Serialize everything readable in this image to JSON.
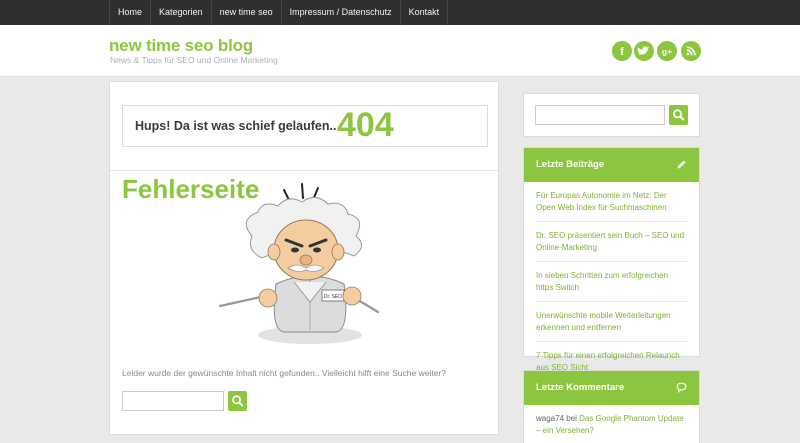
{
  "nav": {
    "items": [
      "Home",
      "Kategorien",
      "new time seo",
      "Impressum / Datenschutz",
      "Kontakt"
    ]
  },
  "header": {
    "site_title": "new time seo blog",
    "site_description": "News & Tipps für SEO und Online Marketing",
    "social": [
      {
        "name": "facebook-icon",
        "glyph": "f"
      },
      {
        "name": "twitter-icon",
        "glyph": "t"
      },
      {
        "name": "googleplus-icon",
        "glyph": "g+"
      },
      {
        "name": "rss-icon",
        "glyph": "rss"
      }
    ]
  },
  "main": {
    "error_text": "Hups! Da ist was schief gelaufen..",
    "error_code": "404",
    "heading": "Fehlerseite",
    "badge": "Dr. SEO",
    "message": "Leider wurde der gewünschte Inhalt nicht gefunden.. Vielleicht hilft eine Suche weiter?",
    "search_placeholder": ""
  },
  "sidebar": {
    "search_placeholder": "",
    "recent_posts": {
      "title": "Letzte Beiträge",
      "items": [
        "Für Europas Autonomie im Netz: Der Open Web Index für Suchmaschinen",
        "Dr. SEO präsentiert sein Buch – SEO und Online-Marketing",
        "In sieben Schritten zum erfolgreichen https Switch",
        "Unerwünschte mobile Weiterleitungen erkennen und entfernen",
        "7 Tipps für einen erfolgreichen Relaunch aus SEO Sicht"
      ]
    },
    "recent_comments": {
      "title": "Letzte Kommentare",
      "items": [
        {
          "author": "waga74",
          "connector": " bei ",
          "post": "Das Google Phantom Update – ein Versehen?"
        }
      ]
    }
  },
  "colors": {
    "accent": "#8cc63e",
    "topbar": "#2f2f2f",
    "background": "#e9e9e9"
  }
}
